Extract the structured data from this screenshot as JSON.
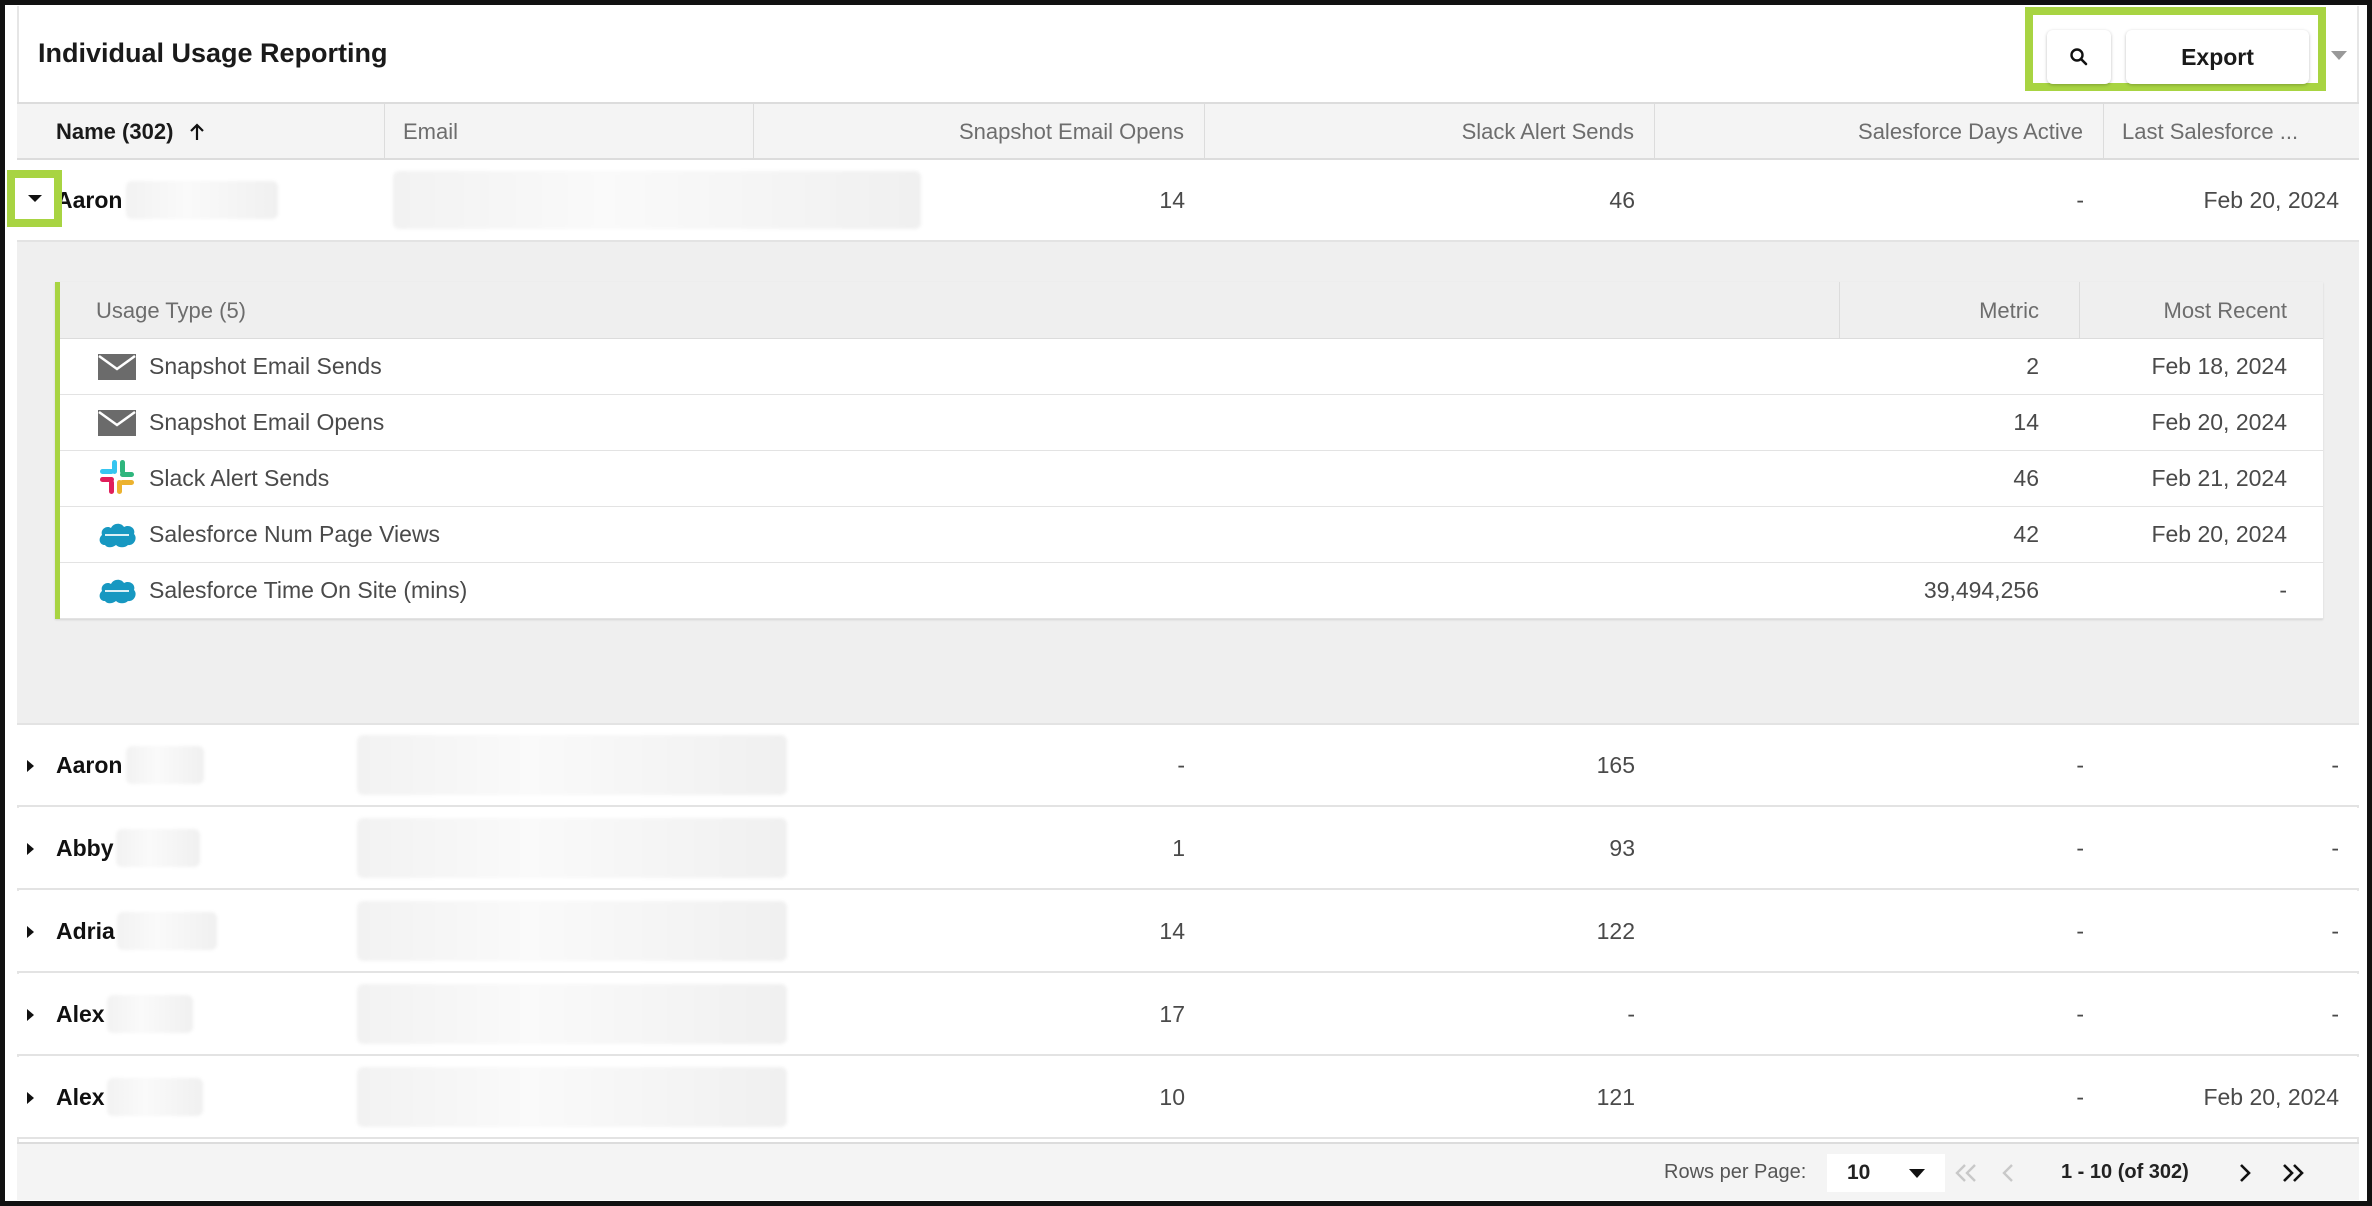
{
  "header": {
    "title": "Individual Usage Reporting",
    "export_label": "Export"
  },
  "columns": {
    "name": "Name (302)",
    "email": "Email",
    "opens": "Snapshot Email Opens",
    "slack": "Slack Alert Sends",
    "sf_days": "Salesforce Days Active",
    "last_sf": "Last Salesforce ..."
  },
  "expanded_row": {
    "name": "Aaron",
    "opens": "14",
    "slack": "46",
    "sf_days": "-",
    "last_sf": "Feb 20, 2024"
  },
  "usage": {
    "head_type": "Usage Type (5)",
    "head_metric": "Metric",
    "head_recent": "Most Recent",
    "items": [
      {
        "icon": "mail-icon",
        "label": "Snapshot Email Sends",
        "metric": "2",
        "recent": "Feb 18, 2024"
      },
      {
        "icon": "mail-icon",
        "label": "Snapshot Email Opens",
        "metric": "14",
        "recent": "Feb 20, 2024"
      },
      {
        "icon": "slack-icon",
        "label": "Slack Alert Sends",
        "metric": "46",
        "recent": "Feb 21, 2024"
      },
      {
        "icon": "salesforce-icon",
        "label": "Salesforce Num Page Views",
        "metric": "42",
        "recent": "Feb 20, 2024"
      },
      {
        "icon": "salesforce-icon",
        "label": "Salesforce Time On Site (mins)",
        "metric": "39,494,256",
        "recent": "-"
      }
    ]
  },
  "rows": [
    {
      "name": "Aaron",
      "opens": "-",
      "slack": "165",
      "sf_days": "-",
      "last_sf": "-"
    },
    {
      "name": "Abby",
      "opens": "1",
      "slack": "93",
      "sf_days": "-",
      "last_sf": "-"
    },
    {
      "name": "Adria",
      "opens": "14",
      "slack": "122",
      "sf_days": "-",
      "last_sf": "-"
    },
    {
      "name": "Alex",
      "opens": "17",
      "slack": "-",
      "sf_days": "-",
      "last_sf": "-"
    },
    {
      "name": "Alex",
      "opens": "10",
      "slack": "121",
      "sf_days": "-",
      "last_sf": "Feb 20, 2024"
    }
  ],
  "footer": {
    "rows_per_page_label": "Rows per Page:",
    "rows_per_page_value": "10",
    "range": "1 - 10 (of 302)"
  },
  "colors": {
    "highlight": "#a8d442",
    "header_bg": "#f4f4f4",
    "expanded_bg": "#efefef"
  }
}
